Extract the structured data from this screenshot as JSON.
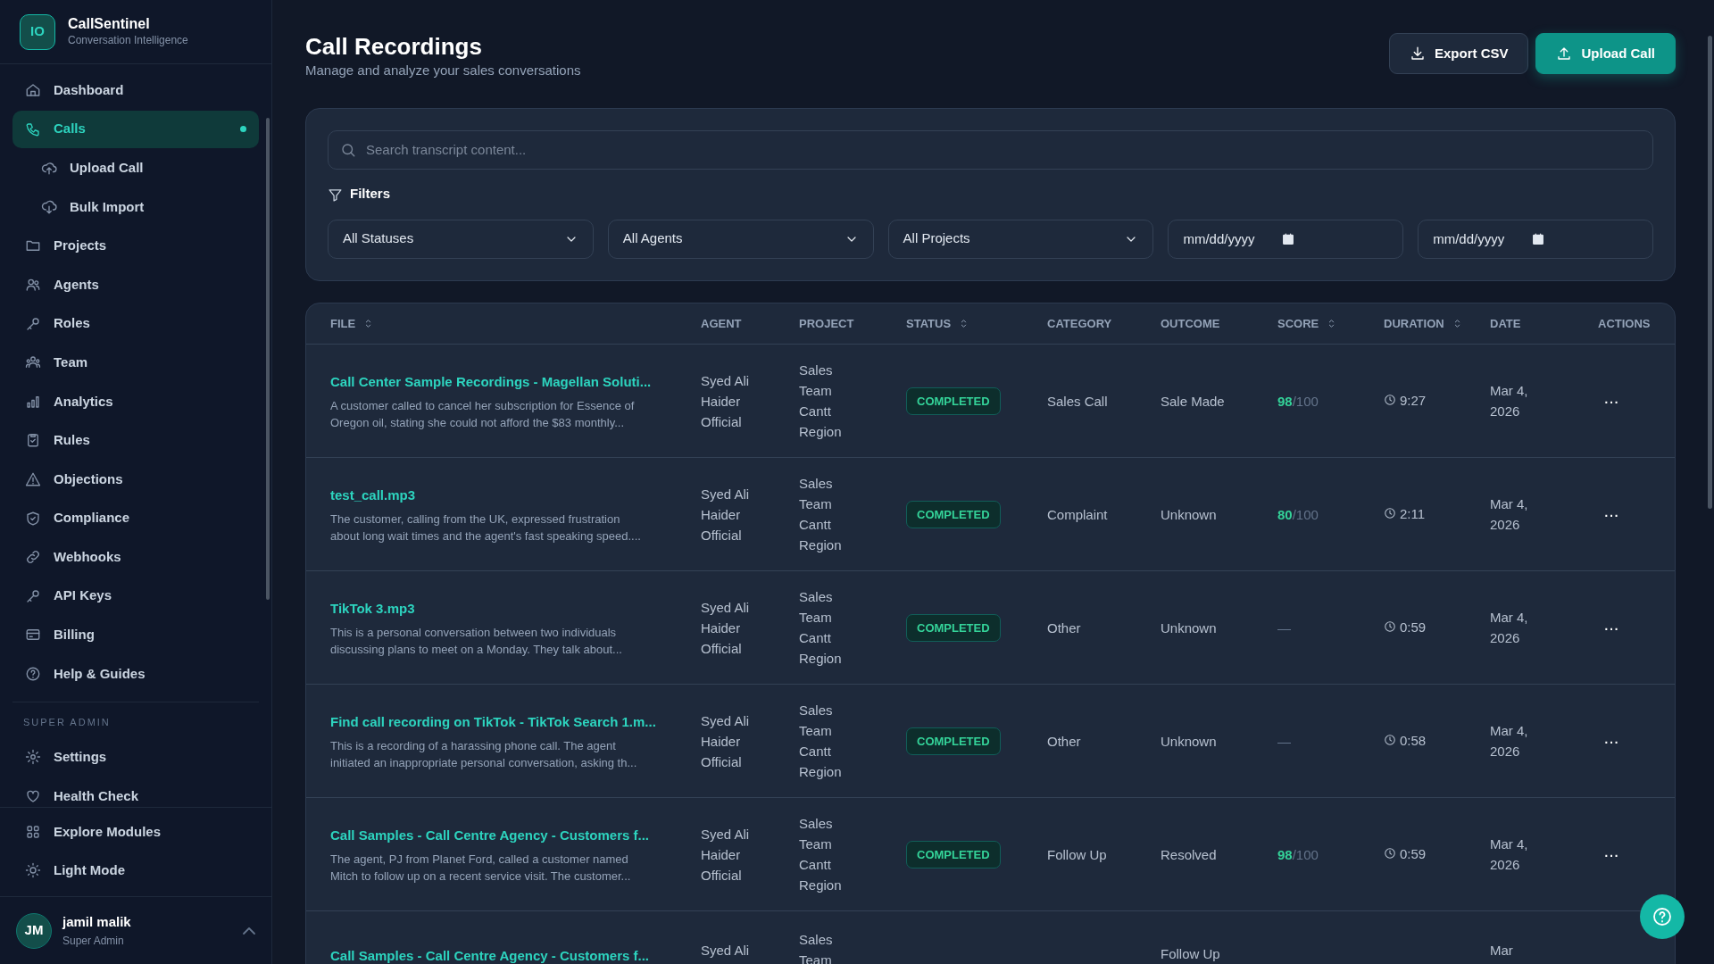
{
  "brand": {
    "logo": "IO",
    "name": "CallSentinel",
    "tagline": "Conversation Intelligence"
  },
  "sidebar": {
    "items": [
      {
        "label": "Dashboard",
        "selected": false
      },
      {
        "label": "Calls",
        "selected": true,
        "children": [
          {
            "label": "Upload Call",
            "selected": false
          },
          {
            "label": "Bulk Import",
            "selected": false
          }
        ]
      },
      {
        "label": "Projects",
        "selected": false
      },
      {
        "label": "Agents",
        "selected": false
      },
      {
        "label": "Roles",
        "selected": false
      },
      {
        "label": "Team",
        "selected": false
      },
      {
        "label": "Analytics",
        "selected": false
      },
      {
        "label": "Rules",
        "selected": false
      },
      {
        "label": "Objections",
        "selected": false
      },
      {
        "label": "Compliance",
        "selected": false
      },
      {
        "label": "Webhooks",
        "selected": false
      },
      {
        "label": "API Keys",
        "selected": false
      },
      {
        "label": "Billing",
        "selected": false
      },
      {
        "label": "Help & Guides",
        "selected": false
      }
    ],
    "section": "SUPER ADMIN",
    "admin_items": [
      {
        "label": "Settings",
        "selected": false
      },
      {
        "label": "Health Check",
        "selected": false
      }
    ],
    "footer_items": [
      {
        "label": "Explore Modules"
      },
      {
        "label": "Light Mode"
      }
    ],
    "user": {
      "initials": "JM",
      "name": "jamil malik",
      "role": "Super Admin"
    }
  },
  "header": {
    "title": "Call Recordings",
    "subtitle": "Manage and analyze your sales conversations",
    "buttons": [
      {
        "label": "Export CSV",
        "kind": "secondary"
      },
      {
        "label": "Upload Call",
        "kind": "primary"
      }
    ]
  },
  "search": {
    "placeholder": "Search transcript content..."
  },
  "filters": {
    "label": "Filters",
    "selects": [
      "All Statuses",
      "All Agents",
      "All Projects"
    ],
    "dates": [
      {
        "placeholder": "mm/dd/yyyy"
      },
      {
        "placeholder": "mm/dd/yyyy"
      }
    ]
  },
  "table": {
    "columns": [
      {
        "label": "FILE",
        "sortable": true
      },
      {
        "label": "AGENT",
        "sortable": false
      },
      {
        "label": "PROJECT",
        "sortable": false
      },
      {
        "label": "STATUS",
        "sortable": true
      },
      {
        "label": "CATEGORY",
        "sortable": false
      },
      {
        "label": "OUTCOME",
        "sortable": false
      },
      {
        "label": "SCORE",
        "sortable": true
      },
      {
        "label": "DURATION",
        "sortable": true
      },
      {
        "label": "DATE",
        "sortable": false
      },
      {
        "label": "ACTIONS",
        "sortable": false
      }
    ],
    "rows": [
      {
        "file": "Call Center Sample Recordings - Magellan Soluti...",
        "summary": "A customer called to cancel her subscription for Essence of Oregon oil, stating she could not afford the $83 monthly...",
        "agent": "Syed Ali Haider Official",
        "project": "Sales Team Cantt Region",
        "status": "COMPLETED",
        "category": "Sales Call",
        "outcome": "Sale Made",
        "score": "98",
        "score_max": "/100",
        "duration": "9:27",
        "date": "Mar 4, 2026",
        "actions": "···"
      },
      {
        "file": "test_call.mp3",
        "summary": "The customer, calling from the UK, expressed frustration about long wait times and the agent's fast speaking speed....",
        "agent": "Syed Ali Haider Official",
        "project": "Sales Team Cantt Region",
        "status": "COMPLETED",
        "category": "Complaint",
        "outcome": "Unknown",
        "score": "80",
        "score_max": "/100",
        "duration": "2:11",
        "date": "Mar 4, 2026",
        "actions": "···"
      },
      {
        "file": "TikTok 3.mp3",
        "summary": "This is a personal conversation between two individuals discussing plans to meet on a Monday. They talk about...",
        "agent": "Syed Ali Haider Official",
        "project": "Sales Team Cantt Region",
        "status": "COMPLETED",
        "category": "Other",
        "outcome": "Unknown",
        "score": "—",
        "duration": "0:59",
        "date": "Mar 4, 2026",
        "actions": "···"
      },
      {
        "file": "Find call recording on TikTok - TikTok Search 1.m...",
        "summary": "This is a recording of a harassing phone call. The agent initiated an inappropriate personal conversation, asking th...",
        "agent": "Syed Ali Haider Official",
        "project": "Sales Team Cantt Region",
        "status": "COMPLETED",
        "category": "Other",
        "outcome": "Unknown",
        "score": "—",
        "duration": "0:58",
        "date": "Mar 4, 2026",
        "actions": "···"
      },
      {
        "file": "Call Samples - Call Centre Agency - Customers f...",
        "summary": "The agent, PJ from Planet Ford, called a customer named Mitch to follow up on a recent service visit. The customer...",
        "agent": "Syed Ali Haider Official",
        "project": "Sales Team Cantt Region",
        "status": "COMPLETED",
        "category": "Follow Up",
        "outcome": "Resolved",
        "score": "98",
        "score_max": "/100",
        "duration": "0:59",
        "date": "Mar 4, 2026",
        "actions": "···"
      },
      {
        "file": "Call Samples - Call Centre Agency - Customers f...",
        "agent": "Syed Ali",
        "project": "Sales Team",
        "outcome": "Follow Up",
        "date": "Mar"
      }
    ]
  }
}
